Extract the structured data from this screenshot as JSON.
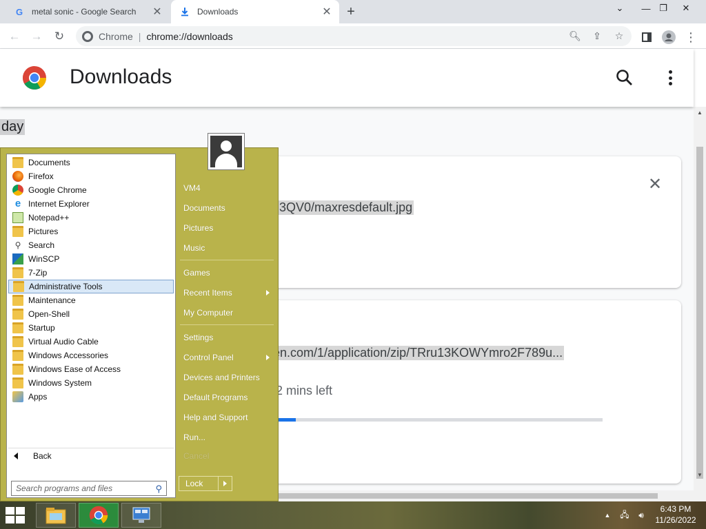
{
  "browser": {
    "tabs": [
      {
        "title": "metal sonic - Google Search",
        "favicon": "google-g-icon"
      },
      {
        "title": "Downloads",
        "favicon": "download-icon"
      }
    ],
    "omnibox": {
      "chip": "Chrome",
      "url": "chrome://downloads"
    }
  },
  "downloads": {
    "title": "Downloads",
    "date_header": "day",
    "items": [
      {
        "url_fragment": "3QV0/maxresdefault.jpg"
      },
      {
        "url_fragment": "en.com/1/application/zip/TRru13KOWYmro2F789u...",
        "status": "2 mins left",
        "progress": 0.22
      }
    ]
  },
  "start_menu": {
    "programs": [
      {
        "label": "Documents",
        "icon": "documents-folder-icon"
      },
      {
        "label": "Firefox",
        "icon": "firefox-icon"
      },
      {
        "label": "Google Chrome",
        "icon": "chrome-icon"
      },
      {
        "label": "Internet Explorer",
        "icon": "internet-explorer-icon"
      },
      {
        "label": "Notepad++",
        "icon": "notepad-plus-plus-icon"
      },
      {
        "label": "Pictures",
        "icon": "pictures-folder-icon"
      },
      {
        "label": "Search",
        "icon": "search-icon"
      },
      {
        "label": "WinSCP",
        "icon": "winscp-icon"
      },
      {
        "label": "7-Zip",
        "icon": "folder-icon"
      },
      {
        "label": "Administrative Tools",
        "icon": "folder-icon"
      },
      {
        "label": "Maintenance",
        "icon": "folder-icon"
      },
      {
        "label": "Open-Shell",
        "icon": "folder-icon"
      },
      {
        "label": "Startup",
        "icon": "folder-icon"
      },
      {
        "label": "Virtual Audio Cable",
        "icon": "folder-icon"
      },
      {
        "label": "Windows Accessories",
        "icon": "folder-icon"
      },
      {
        "label": "Windows Ease of Access",
        "icon": "folder-icon"
      },
      {
        "label": "Windows System",
        "icon": "folder-icon"
      },
      {
        "label": "Apps",
        "icon": "apps-icon"
      }
    ],
    "selected_program": "Administrative Tools",
    "back_label": "Back",
    "search_placeholder": "Search programs and files",
    "right_items": {
      "user": "VM4",
      "documents": "Documents",
      "pictures": "Pictures",
      "music": "Music",
      "games": "Games",
      "recent_items": "Recent Items",
      "my_computer": "My Computer",
      "settings": "Settings",
      "control_panel": "Control Panel",
      "devices_printers": "Devices and Printers",
      "default_programs": "Default Programs",
      "help_support": "Help and Support",
      "run": "Run...",
      "faint": "Cancel"
    },
    "lock_label": "Lock"
  },
  "taskbar": {
    "time": "6:43 PM",
    "date": "11/26/2022"
  },
  "colors": {
    "start_menu_bg": "#b9b34b",
    "progress_fill": "#1a73e8",
    "selection": "#d9e8f7"
  }
}
